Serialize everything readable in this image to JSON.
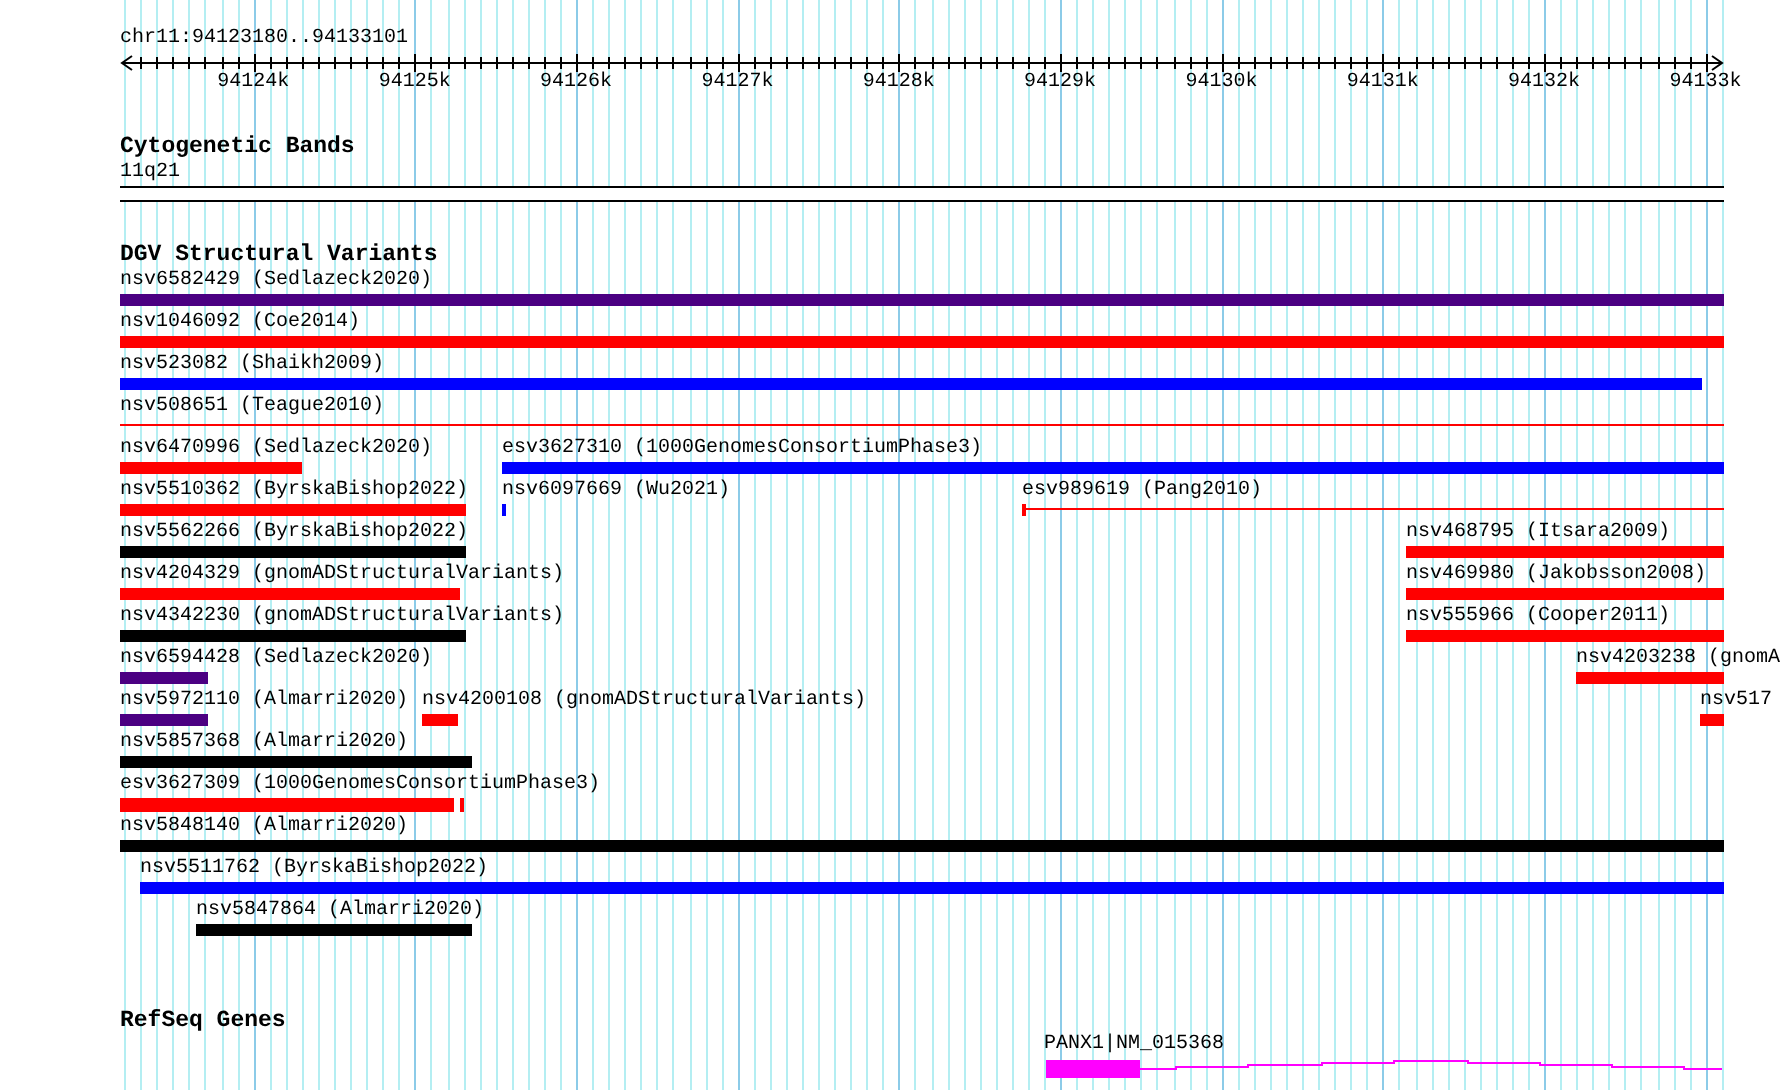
{
  "ruler": {
    "location": "chr11:94123180..94133101",
    "ticks": [
      "94124k",
      "94125k",
      "94126k",
      "94127k",
      "94128k",
      "94129k",
      "94130k",
      "94131k",
      "94132k",
      "94133k"
    ]
  },
  "tracks": [
    {
      "title": "Cytogenetic Bands",
      "kind": "bands",
      "features": [
        {
          "label": "11q21"
        }
      ]
    },
    {
      "title": "DGV Structural Variants",
      "kind": "variants",
      "features": [
        {
          "label": "nsv6582429 (Sedlazeck2020)",
          "kind": "bar",
          "color": "#4b0082"
        },
        {
          "label": "nsv1046092 (Coe2014)",
          "kind": "bar",
          "color": "#ff0000"
        },
        {
          "label": "nsv523082 (Shaikh2009)",
          "kind": "bar",
          "color": "#0000ff"
        },
        {
          "label": "nsv508651 (Teague2010)",
          "kind": "line",
          "color": "#ff0000"
        },
        {
          "label": "nsv6470996 (Sedlazeck2020)",
          "kind": "bar",
          "color": "#ff0000"
        },
        {
          "label": "esv3627310 (1000GenomesConsortiumPhase3)",
          "kind": "bar",
          "color": "#0000ff"
        },
        {
          "label": "nsv5510362 (ByrskaBishop2022)",
          "kind": "bar",
          "color": "#ff0000"
        },
        {
          "label": "nsv6097669 (Wu2021)",
          "kind": "bar",
          "color": "#0000ff"
        },
        {
          "label": "esv989619 (Pang2010)",
          "kind": "line",
          "color": "#ff0000"
        },
        {
          "label": "nsv5562266 (ByrskaBishop2022)",
          "kind": "bar",
          "color": "#000000"
        },
        {
          "label": "nsv468795 (Itsara2009)",
          "kind": "bar",
          "color": "#ff0000"
        },
        {
          "label": "nsv4204329 (gnomADStructuralVariants)",
          "kind": "bar",
          "color": "#ff0000"
        },
        {
          "label": "nsv469980 (Jakobsson2008)",
          "kind": "bar",
          "color": "#ff0000"
        },
        {
          "label": "nsv4342230 (gnomADStructuralVariants)",
          "kind": "bar",
          "color": "#000000"
        },
        {
          "label": "nsv555966 (Cooper2011)",
          "kind": "bar",
          "color": "#ff0000"
        },
        {
          "label": "nsv6594428 (Sedlazeck2020)",
          "kind": "bar",
          "color": "#4b0082"
        },
        {
          "label": "nsv4203238 (gnomA",
          "kind": "bar",
          "color": "#ff0000"
        },
        {
          "label": "nsv5972110 (Almarri2020)",
          "kind": "bar",
          "color": "#4b0082"
        },
        {
          "label": "nsv4200108 (gnomADStructuralVariants)",
          "kind": "bar",
          "color": "#ff0000"
        },
        {
          "label": "nsv517",
          "kind": "bar",
          "color": "#ff0000"
        },
        {
          "label": "nsv5857368 (Almarri2020)",
          "kind": "bar",
          "color": "#000000"
        },
        {
          "label": "esv3627309 (1000GenomesConsortiumPhase3)",
          "kind": "bar",
          "color": "#ff0000"
        },
        {
          "label": "nsv5848140 (Almarri2020)",
          "kind": "bar",
          "color": "#000000"
        },
        {
          "label": "nsv5511762 (ByrskaBishop2022)",
          "kind": "bar",
          "color": "#0000ff"
        },
        {
          "label": "nsv5847864 (Almarri2020)",
          "kind": "bar",
          "color": "#000000"
        }
      ]
    },
    {
      "title": "RefSeq Genes",
      "kind": "genes",
      "features": [
        {
          "label": "PANX1|NM_015368",
          "color": "#ff00ff"
        }
      ]
    }
  ]
}
